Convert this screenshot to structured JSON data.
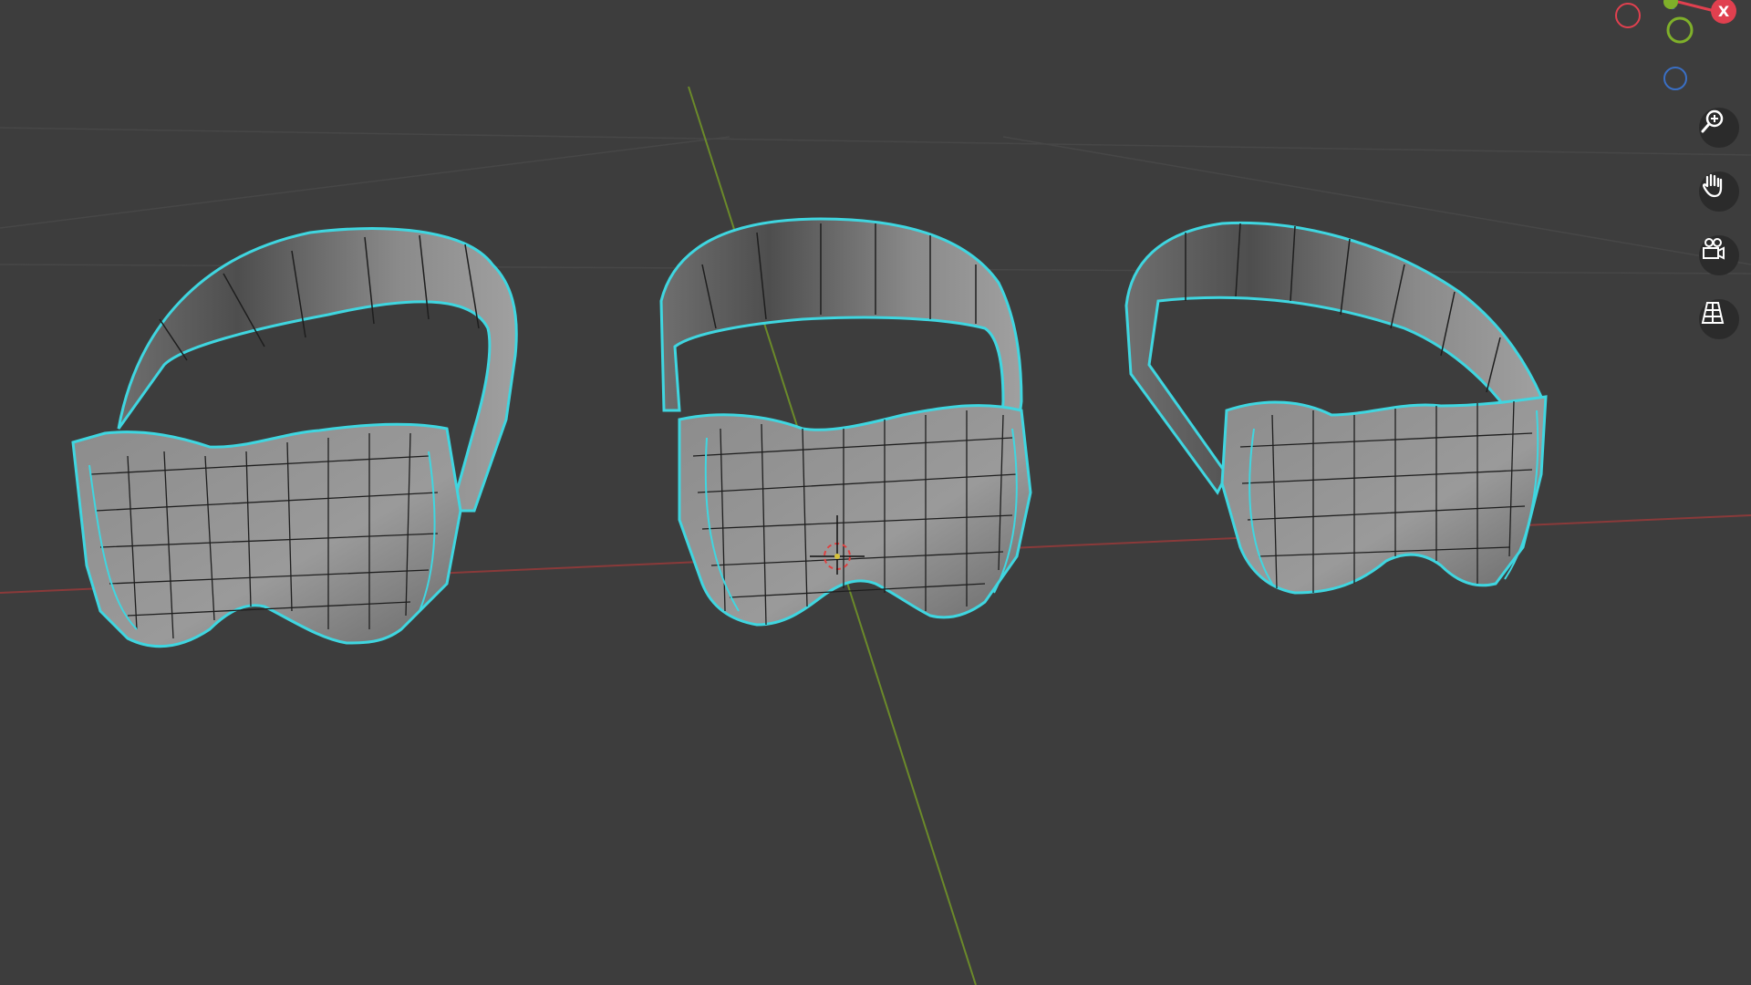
{
  "viewport": {
    "background": "#3d3d3d",
    "x_axis_color": "#8a3a3a",
    "y_axis_color": "#6b8a2a",
    "selection_outline": "#3fd6e0",
    "mesh_fill": "#8f8f8f",
    "objects": [
      "goggles-left",
      "goggles-center",
      "goggles-right"
    ]
  },
  "gizmo": {
    "x_label": "X",
    "x_color": "#e0404f",
    "y_color": "#7fb02a",
    "z_color": "#3a6fc4"
  },
  "nav_tools": [
    {
      "name": "zoom-tool",
      "icon": "zoom-plus-icon"
    },
    {
      "name": "pan-tool",
      "icon": "hand-icon"
    },
    {
      "name": "camera-view-tool",
      "icon": "camera-icon"
    },
    {
      "name": "perspective-toggle",
      "icon": "grid-perspective-icon"
    }
  ]
}
